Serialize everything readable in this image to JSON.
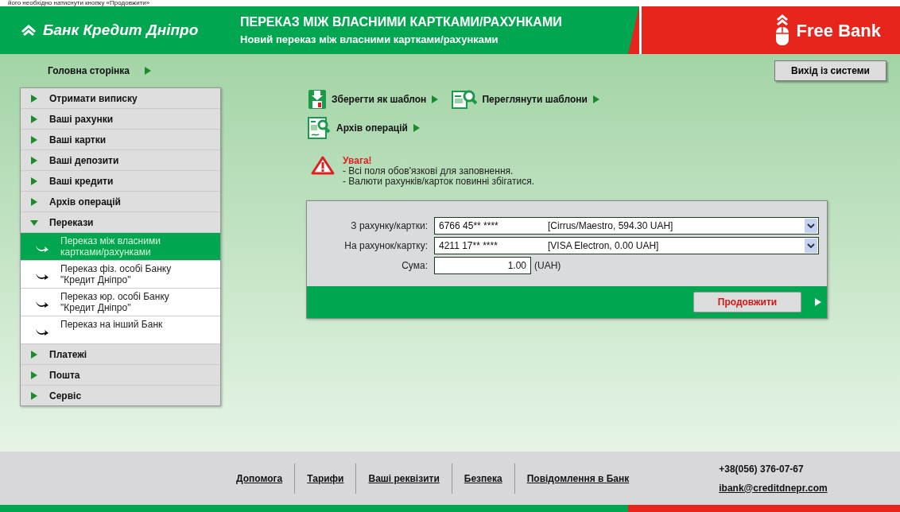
{
  "caption": "його необхідно натиснути кнопку «Продовжити»",
  "header": {
    "bank_name": "Банк Кредит Дніпро",
    "title": "ПЕРЕКАЗ МІЖ ВЛАСНИМИ КАРТКАМИ/РАХУНКАМИ",
    "subtitle": "Новий переказ між власними картками/рахунками",
    "brand": "Free Bank"
  },
  "breadcrumb": "Головна сторінка",
  "logout": "Вихід із системи",
  "sidebar": {
    "items": [
      {
        "label": "Отримати виписку",
        "expanded": false
      },
      {
        "label": "Ваші рахунки",
        "expanded": false
      },
      {
        "label": "Ваші картки",
        "expanded": false
      },
      {
        "label": "Ваші депозити",
        "expanded": false
      },
      {
        "label": "Ваші кредити",
        "expanded": false
      },
      {
        "label": "Архів операцій",
        "expanded": false
      },
      {
        "label": "Перекази",
        "expanded": true,
        "children": [
          {
            "label": "Переказ між власними картками/рахунками",
            "selected": true
          },
          {
            "label": "Переказ фіз. особі Банку \"Кредит Дніпро\"",
            "selected": false
          },
          {
            "label": "Переказ юр. особі Банку \"Кредит Дніпро\"",
            "selected": false
          },
          {
            "label": "Переказ на інший Банк",
            "selected": false
          }
        ]
      },
      {
        "label": "Платежі",
        "expanded": false
      },
      {
        "label": "Пошта",
        "expanded": false
      },
      {
        "label": "Сервіс",
        "expanded": false
      }
    ]
  },
  "actions": [
    {
      "kind": "save",
      "label": "Зберегти як шаблон"
    },
    {
      "kind": "view",
      "label": "Переглянути шаблони"
    },
    {
      "kind": "archive",
      "label": "Архів операцій"
    }
  ],
  "warning": {
    "title": "Увага!",
    "lines": [
      "- Всі поля обов'язкові для заповнення.",
      "- Валюти рахунків/карток повинні збігатися."
    ]
  },
  "form": {
    "fields": [
      {
        "kind": "select",
        "label": "З рахунку/картки:",
        "value": "6766 45** ****",
        "detail": "[Cirrus/Maestro, 594.30 UAH]"
      },
      {
        "kind": "select",
        "label": "На рахунок/картку:",
        "value": "4211 17** ****",
        "detail": "[VISA Electron, 0.00 UAH]"
      },
      {
        "kind": "amount",
        "label": "Сума:",
        "value": "1.00",
        "unit": "(UAH)"
      }
    ],
    "submit": "Продовжити"
  },
  "footer": {
    "links": [
      "Допомога",
      "Тарифи",
      "Ваші реквізити",
      "Безпека",
      "Повідомлення в Банк"
    ],
    "phone": "+38(056) 376-07-67",
    "email": "ibank@creditdnepr.com"
  }
}
